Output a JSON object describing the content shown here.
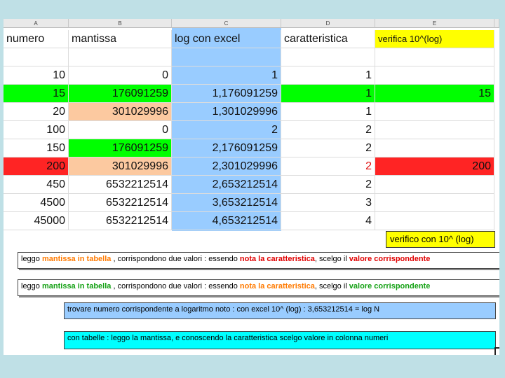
{
  "columns": [
    "A",
    "B",
    "C",
    "D",
    "E"
  ],
  "headers": {
    "numero": "numero",
    "mantissa": "mantissa",
    "log": "log con excel",
    "caratteristica": "caratteristica",
    "verifica": "verifica 10^(log)"
  },
  "rows": [
    {
      "n": "10",
      "m": "0",
      "l": "1",
      "c": "1",
      "v": ""
    },
    {
      "n": "15",
      "m": "176091259",
      "l": "1,176091259",
      "c": "1",
      "v": "15"
    },
    {
      "n": "20",
      "m": "301029996",
      "l": "1,301029996",
      "c": "1",
      "v": ""
    },
    {
      "n": "100",
      "m": "0",
      "l": "2",
      "c": "2",
      "v": ""
    },
    {
      "n": "150",
      "m": "176091259",
      "l": "2,176091259",
      "c": "2",
      "v": ""
    },
    {
      "n": "200",
      "m": "301029996",
      "l": "2,301029996",
      "c": "2",
      "v": "200"
    },
    {
      "n": "450",
      "m": "6532212514",
      "l": "2,653212514",
      "c": "2",
      "v": ""
    },
    {
      "n": "4500",
      "m": "6532212514",
      "l": "3,653212514",
      "c": "3",
      "v": ""
    },
    {
      "n": "45000",
      "m": "6532212514",
      "l": "4,653212514",
      "c": "4",
      "v": ""
    }
  ],
  "verifico": "verifico con 10^ (log)",
  "note1": {
    "a": "leggo ",
    "b": "mantissa in tabella",
    "c": " , corrispondono due valori : essendo ",
    "d": "nota la caratteristica",
    "e": ", scelgo il ",
    "f": "valore corrispondente"
  },
  "note2": {
    "a": "leggo ",
    "b": "mantissa in tabella",
    "c": " , corrispondono due valori : essendo ",
    "d": "nota la caratteristica",
    "e": ", scelgo il ",
    "f": "valore corrispondente"
  },
  "note3": "trovare numero corrispondente a logaritmo noto : con excel 10^ (log)  : 3,653212514 = log N",
  "note4": "con tabelle : leggo la mantissa, e conoscendo la caratteristica scelgo valore in colonna numeri",
  "colors": {
    "blue_column": "#99ccff",
    "green": "#00ff00",
    "peach": "#fcc9a0",
    "red": "#ff2424",
    "yellow": "#ffff00",
    "cyan": "#00ffff",
    "note_blue": "#99ccff"
  }
}
